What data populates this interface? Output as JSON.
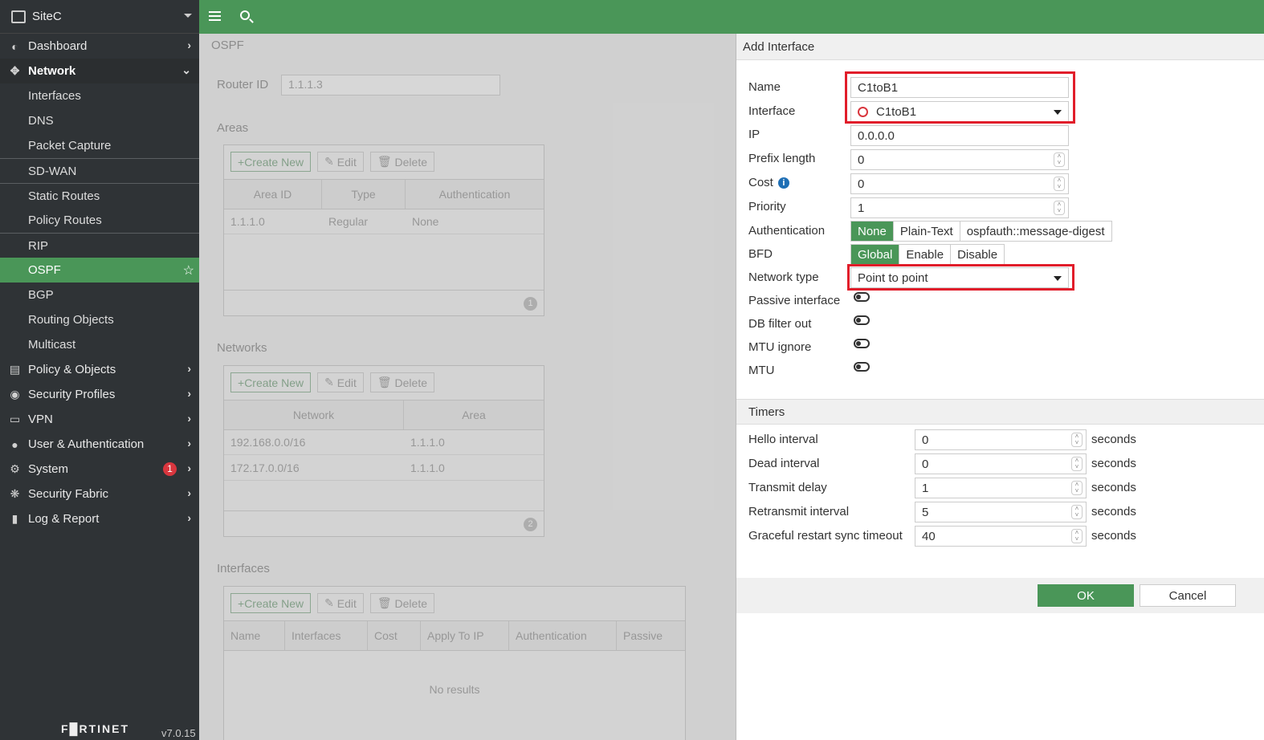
{
  "sidebar": {
    "device": "SiteC",
    "nav": [
      {
        "label": "Dashboard",
        "icon": "dashboard-icon"
      },
      {
        "label": "Network",
        "icon": "network-icon"
      }
    ],
    "network_sub": [
      "Interfaces",
      "DNS",
      "Packet Capture",
      "SD-WAN",
      "Static Routes",
      "Policy Routes",
      "RIP",
      "OSPF",
      "BGP",
      "Routing Objects",
      "Multicast"
    ],
    "nav_after": [
      {
        "label": "Policy & Objects",
        "icon": "policy-icon"
      },
      {
        "label": "Security Profiles",
        "icon": "lock-icon"
      },
      {
        "label": "VPN",
        "icon": "laptop-icon"
      },
      {
        "label": "User & Authentication",
        "icon": "user-icon"
      },
      {
        "label": "System",
        "icon": "gear-icon",
        "badge": "1"
      },
      {
        "label": "Security Fabric",
        "icon": "fabric-icon"
      },
      {
        "label": "Log & Report",
        "icon": "chart-icon"
      }
    ],
    "brand": "F█RTINET",
    "version": "v7.0.15"
  },
  "page": {
    "title": "OSPF",
    "router_id_label": "Router ID",
    "router_id": "1.1.1.3",
    "areas": {
      "label": "Areas",
      "toolbar": [
        "Create New",
        "Edit",
        "Delete"
      ],
      "columns": [
        "Area ID",
        "Type",
        "Authentication"
      ],
      "rows": [
        [
          "1.1.1.0",
          "Regular",
          "None"
        ]
      ],
      "count": "1"
    },
    "networks": {
      "label": "Networks",
      "toolbar": [
        "Create New",
        "Edit",
        "Delete"
      ],
      "columns": [
        "Network",
        "Area"
      ],
      "rows": [
        [
          "192.168.0.0/16",
          "1.1.1.0"
        ],
        [
          "172.17.0.0/16",
          "1.1.1.0"
        ]
      ],
      "count": "2"
    },
    "interfaces": {
      "label": "Interfaces",
      "toolbar": [
        "Create New",
        "Edit",
        "Delete"
      ],
      "columns": [
        "Name",
        "Interfaces",
        "Cost",
        "Apply To IP",
        "Authentication",
        "Passive"
      ],
      "empty": "No results"
    }
  },
  "dialog": {
    "title": "Add Interface",
    "name_label": "Name",
    "name_value": "C1toB1",
    "interface_label": "Interface",
    "interface_value": "C1toB1",
    "ip_label": "IP",
    "ip_value": "0.0.0.0",
    "prefix_label": "Prefix length",
    "prefix_value": "0",
    "cost_label": "Cost",
    "cost_value": "0",
    "priority_label": "Priority",
    "priority_value": "1",
    "auth_label": "Authentication",
    "auth_options": [
      "None",
      "Plain-Text",
      "ospfauth::message-digest"
    ],
    "bfd_label": "BFD",
    "bfd_options": [
      "Global",
      "Enable",
      "Disable"
    ],
    "network_type_label": "Network type",
    "network_type_value": "Point to point",
    "passive_label": "Passive interface",
    "dbfilter_label": "DB filter out",
    "mtuignore_label": "MTU ignore",
    "mtu_label": "MTU",
    "timers_label": "Timers",
    "timers": [
      {
        "label": "Hello interval",
        "value": "0",
        "unit": "seconds"
      },
      {
        "label": "Dead interval",
        "value": "0",
        "unit": "seconds"
      },
      {
        "label": "Transmit delay",
        "value": "1",
        "unit": "seconds"
      },
      {
        "label": "Retransmit interval",
        "value": "5",
        "unit": "seconds"
      },
      {
        "label": "Graceful restart sync timeout",
        "value": "40",
        "unit": "seconds"
      }
    ],
    "ok": "OK",
    "cancel": "Cancel"
  },
  "colors": {
    "accent": "#4a9658",
    "highlight": "#e11d2a",
    "sidebar": "#2f3336"
  }
}
